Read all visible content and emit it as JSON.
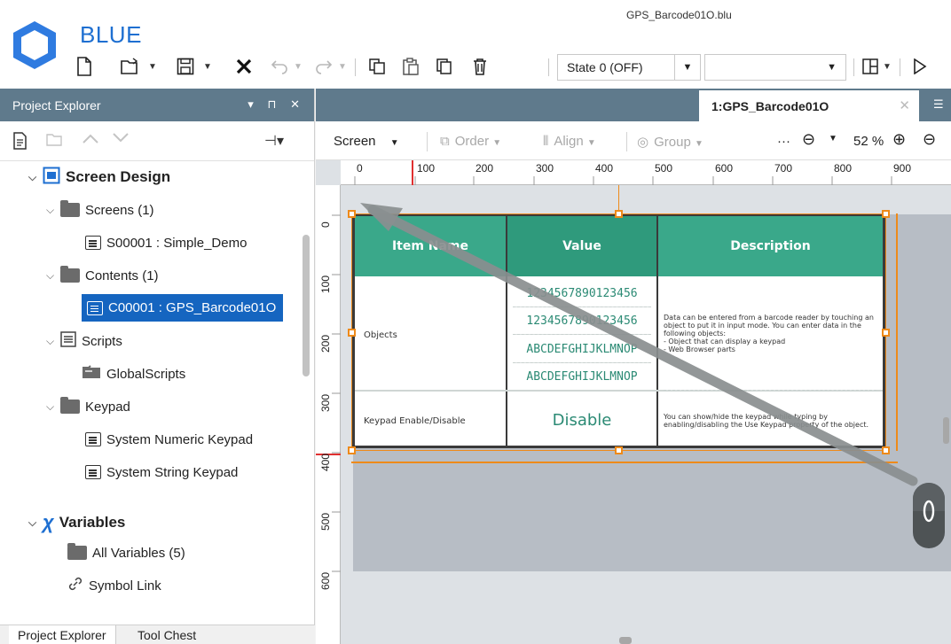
{
  "window": {
    "app_name": "BLUE",
    "file_name": "GPS_Barcode01O.blu"
  },
  "toolbar": {
    "state_value": "State 0 (OFF)",
    "icons": [
      "new-file-icon",
      "open-folder-icon",
      "save-icon",
      "close-icon",
      "undo-icon",
      "redo-icon",
      "copy-icon",
      "paste-icon",
      "duplicate-icon",
      "delete-icon",
      "layout-icon",
      "run-icon"
    ]
  },
  "project_explorer": {
    "title": "Project Explorer",
    "header_icons": "▾ ⊓ ✕",
    "tree": {
      "screen_design": "Screen Design",
      "screens": "Screens (1)",
      "screen_item": "S00001 : Simple_Demo",
      "contents": "Contents (1)",
      "content_item": "C00001 : GPS_Barcode01O",
      "scripts": "Scripts",
      "global_scripts": "GlobalScripts",
      "keypad": "Keypad",
      "numeric_keypad": "System Numeric Keypad",
      "string_keypad": "System String Keypad",
      "variables": "Variables",
      "all_variables": "All Variables (5)",
      "symbol_link": "Symbol Link"
    },
    "bottom_tabs": [
      "Project Explorer",
      "Tool Chest"
    ]
  },
  "document": {
    "tab_label": "1:GPS_Barcode01O",
    "design_toolbar": {
      "screen": "Screen",
      "order": "Order",
      "align": "Align",
      "group": "Group",
      "more": "···",
      "zoom": "52 %"
    },
    "ruler_h": [
      "0",
      "100",
      "200",
      "300",
      "400",
      "500",
      "600",
      "700",
      "800",
      "900"
    ],
    "ruler_v": [
      "0",
      "100",
      "200",
      "300",
      "400",
      "500",
      "600"
    ]
  },
  "table": {
    "headers": [
      "Item Name",
      "Value",
      "Description"
    ],
    "rows": [
      {
        "name": "Objects",
        "values": [
          "1234567890123456",
          "1234567890123456",
          "ABCDEFGHIJKLMNOP",
          "ABCDEFGHIJKLMNOP"
        ],
        "description": "Data can be entered from a barcode reader by touching an object to put it in input mode. You can enter data in the following objects:\n- Object that can display a keypad\n- Web Browser parts"
      },
      {
        "name": "Keypad Enable/Disable",
        "values": [
          "Disable"
        ],
        "description": "You can show/hide the keypad while typing by enabling/disabling the Use Keypad property of the object."
      }
    ]
  },
  "colors": {
    "accent": "#1e6fd1",
    "panel_header": "#5f7a8c",
    "table_header": "#3aa88a",
    "selection": "#ee8a1a",
    "selected_item": "#1565c0"
  }
}
